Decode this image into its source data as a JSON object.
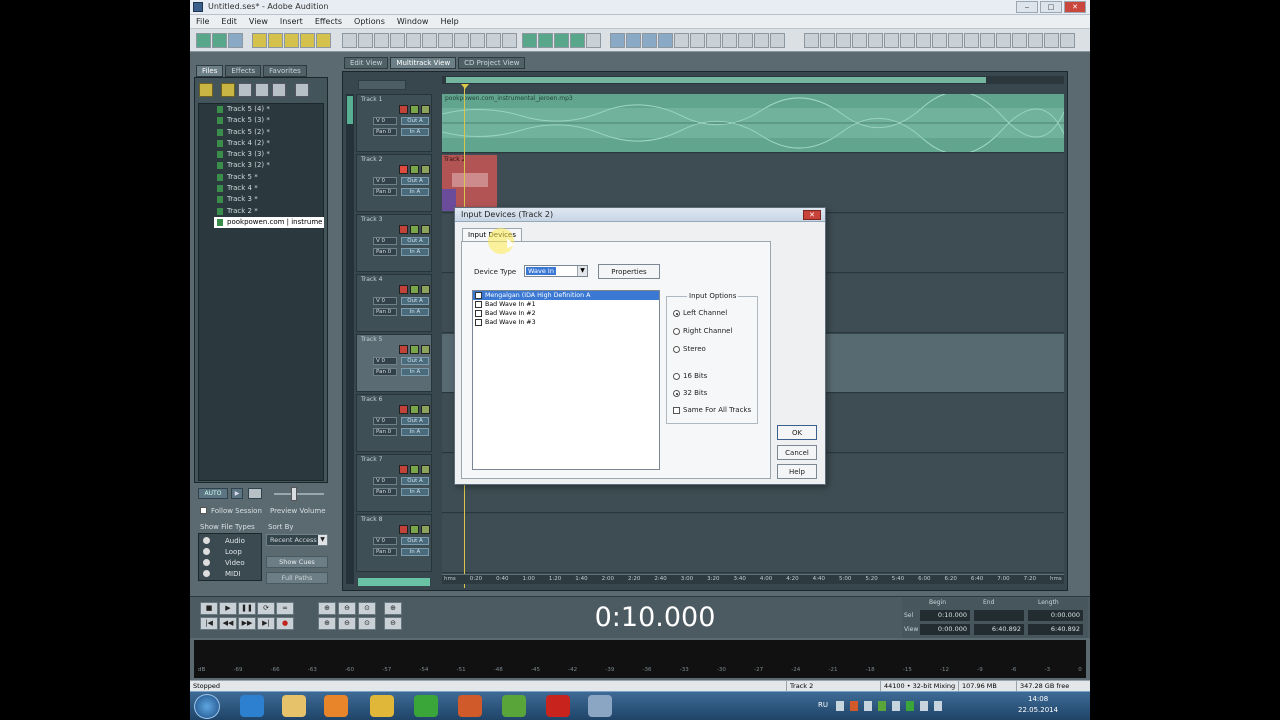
{
  "window": {
    "title": "Untitled.ses* - Adobe Audition",
    "controls": [
      "‒",
      "□",
      "✕"
    ]
  },
  "menu": [
    "File",
    "Edit",
    "View",
    "Insert",
    "Effects",
    "Options",
    "Window",
    "Help"
  ],
  "left_panel": {
    "tabs": [
      "Files",
      "Effects",
      "Favorites"
    ],
    "files": [
      "Track 5 (4) *",
      "Track 5 (3) *",
      "Track 5 (2) *",
      "Track 4 (2) *",
      "Track 3 (3) *",
      "Track 3 (2) *",
      "Track 5 *",
      "Track 4 *",
      "Track 3 *",
      "Track 2 *",
      "pookpowen.com | instrume"
    ],
    "auto_play": "AUTO",
    "follow_session": "Follow Session",
    "preview_volume": "Preview Volume",
    "show_file_types": "Show File Types",
    "file_types": [
      "Audio",
      "Loop",
      "Video",
      "MIDI"
    ],
    "sort_by_label": "Sort By",
    "sort_by_value": "Recent Access",
    "show_cues": "Show Cues",
    "full_paths": "Full Paths"
  },
  "view_tabs": [
    "Edit View",
    "Multitrack View",
    "CD Project View"
  ],
  "tracks": [
    {
      "name": "Track 1",
      "vol": "V 0",
      "pan": "Pan 0",
      "out": "Out A",
      "in": "In A"
    },
    {
      "name": "Track 2",
      "vol": "V 0",
      "pan": "Pan 0",
      "out": "Out A",
      "in": "In A"
    },
    {
      "name": "Track 3",
      "vol": "V 0",
      "pan": "Pan 0",
      "out": "Out A",
      "in": "In A"
    },
    {
      "name": "Track 4",
      "vol": "V 0",
      "pan": "Pan 0",
      "out": "Out A",
      "in": "In A"
    },
    {
      "name": "Track 5",
      "vol": "V 0",
      "pan": "Pan 0",
      "out": "Out A",
      "in": "In A"
    },
    {
      "name": "Track 6",
      "vol": "V 0",
      "pan": "Pan 0",
      "out": "Out A",
      "in": "In A"
    },
    {
      "name": "Track 7",
      "vol": "V 0",
      "pan": "Pan 0",
      "out": "Out A",
      "in": "In A"
    },
    {
      "name": "Track 8",
      "vol": "V 0",
      "pan": "Pan 0",
      "out": "Out A",
      "in": "In A"
    }
  ],
  "clips": {
    "track1": "pookpowen.com_instrumental_jeroen.mp3",
    "track2": "Track 2"
  },
  "ruler": [
    "hms",
    "0:20",
    "0:40",
    "1:00",
    "1:20",
    "1:40",
    "2:00",
    "2:20",
    "2:40",
    "3:00",
    "3:20",
    "3:40",
    "4:00",
    "4:20",
    "4:40",
    "5:00",
    "5:20",
    "5:40",
    "6:00",
    "6:20",
    "6:40",
    "7:00",
    "7:20",
    "hms"
  ],
  "dialog": {
    "title": "Input Devices (Track 2)",
    "tab": "Input Devices",
    "device_type_label": "Device Type",
    "device_type_value": "Wave In",
    "properties": "Properties",
    "devices": [
      "Mengalgan (IDA High Definition A",
      "Bad Wave In #1",
      "Bad Wave In #2",
      "Bad Wave In #3"
    ],
    "input_options": "Input Options",
    "channels": [
      "Left Channel",
      "Right Channel",
      "Stereo"
    ],
    "bits": [
      "16 Bits",
      "32 Bits"
    ],
    "same_for_all": "Same For All Tracks",
    "ok": "OK",
    "cancel": "Cancel",
    "help": "Help"
  },
  "time_display": "0:10.000",
  "selection": {
    "headers": [
      "Begin",
      "End",
      "Length"
    ],
    "sel_label": "Sel",
    "view_label": "View",
    "sel": [
      "0:10.000",
      "",
      "0:00.000"
    ],
    "view": [
      "0:00.000",
      "6:40.892",
      "6:40.892"
    ]
  },
  "level_ticks": [
    "dB",
    "-69",
    "-66",
    "-63",
    "-60",
    "-57",
    "-54",
    "-51",
    "-48",
    "-45",
    "-42",
    "-39",
    "-36",
    "-33",
    "-30",
    "-27",
    "-24",
    "-21",
    "-18",
    "-15",
    "-12",
    "-9",
    "-6",
    "-3",
    "0"
  ],
  "status": {
    "state": "Stopped",
    "track": "Track 2",
    "format": "44100 • 32-bit Mixing",
    "size": "107.96 MB",
    "free": "347.28 GB free"
  },
  "clock": {
    "time": "14:08",
    "date": "22.05.2014",
    "lang": "RU"
  }
}
